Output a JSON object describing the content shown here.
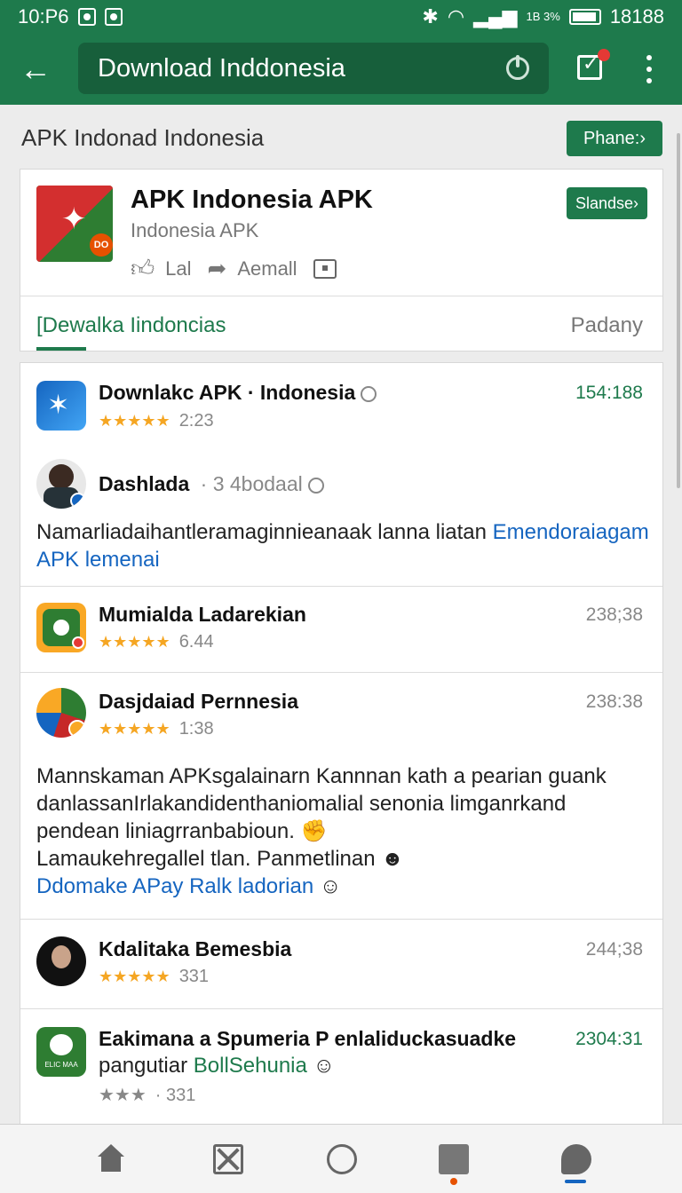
{
  "status": {
    "time": "10:P6",
    "right_text": "18188",
    "small": "1B 3%"
  },
  "appbar": {
    "search_text": "Download Inddonesia"
  },
  "section": {
    "title": "APK Indonad Indonesia",
    "phone_btn": "Phane:›"
  },
  "featured": {
    "badge": "DO",
    "title": "APK Indonesia APK",
    "subtitle": "Indonesia APK",
    "like_label": "Lal",
    "share_label": "Aemall",
    "stand_btn": "Slandse›",
    "tab_left": "[Dewalka Iindoncias",
    "tab_right": "Padany"
  },
  "list": {
    "item1": {
      "title": "Downlakc APK · Indonesia",
      "stars": "★★★★★",
      "rating": "2:23",
      "time": "154:188"
    },
    "item2": {
      "title": "Dashlada",
      "meta": "· 3 4bodaal",
      "text": "Namarliadaihantleramaginnieanaak lanna liatan",
      "link1": "Emendoraiagam",
      "link2": "APK lemenai"
    },
    "item3": {
      "title": "Mumialda Ladarekian",
      "stars": "★★★★★",
      "rating": "6.44",
      "time": "238;38"
    },
    "item4": {
      "title": "Dasjdaiad Pernnesia",
      "stars": "★★★★★",
      "rating": "1:38",
      "time": "238:38",
      "line1": "Mannskaman APKsgalainarn Kannnan kath a pearian guank",
      "line2": "danlassanIrlakandidenthaniomalial senonia limganrkand",
      "line3": "pendean liniagrranbabioun.",
      "line4": "Lamaukehregallel tlan. Panmetlinan",
      "link": "Ddomake APay Ralk ladorian"
    },
    "item5": {
      "title": "Kdalitaka Bemesbia",
      "stars": "★★★★★",
      "rating": "331",
      "time": "244;38"
    },
    "item6": {
      "title": "Eakimana a Spumeria P enlaliduckasuadke",
      "line2": "pangutiar",
      "link": "BollSehunia",
      "stars": "★★★",
      "rating": "· 331",
      "time": "2304:31",
      "icon_text": "ELIC MAA"
    }
  },
  "colors": {
    "primary": "#1e7a4c",
    "link": "#1565c0",
    "star": "#f5a623"
  }
}
